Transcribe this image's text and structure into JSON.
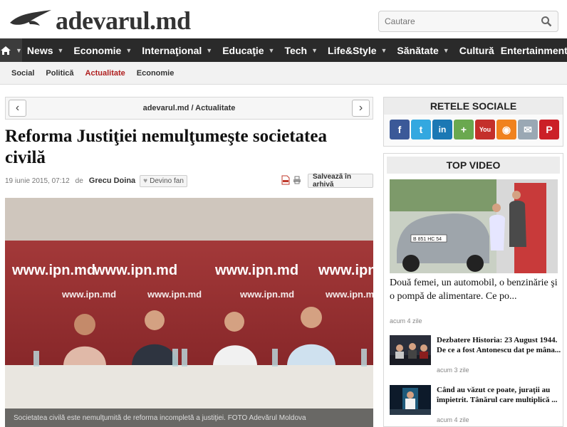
{
  "site": {
    "logo_text": "adevarul.md"
  },
  "search": {
    "placeholder": "Cautare"
  },
  "nav": {
    "items": [
      "News",
      "Economie",
      "Internaţional",
      "Educaţie",
      "Tech",
      "Life&Style",
      "Sănătate",
      "Cultură",
      "Entertainment"
    ]
  },
  "subnav": {
    "items": [
      "Social",
      "Politică",
      "Actualitate",
      "Economie"
    ],
    "active": "Actualitate"
  },
  "breadcrumb": {
    "home": "adevarul.md",
    "separator": " / ",
    "section": "Actualitate"
  },
  "article": {
    "title": "Reforma Justiţiei nemulţumeşte societatea civilă",
    "date": "19 iunie 2015, 07:12",
    "by": "de",
    "author": "Grecu Doina",
    "fan_label": "Devino fan",
    "save_label": "Salvează în arhivă",
    "caption": "Societatea civilă este nemulţumită de reforma incompletă a justiţiei. FOTO Adevărul Moldova",
    "banner_text": "www.ipn.md"
  },
  "sidebar": {
    "social_title": "RETELE SOCIALE",
    "social_icons": [
      "facebook-icon",
      "twitter-icon",
      "linkedin-icon",
      "googleplus-icon",
      "youtube-icon",
      "rss-icon",
      "email-icon",
      "pinterest-icon"
    ],
    "video_title": "TOP VIDEO",
    "main_video": {
      "title": "Două femei, un automobil, o benzinărie şi o pompă de alimentare. Ce po...",
      "date": "acum 4 zile",
      "plate": "B 851 HC 54"
    },
    "videos": [
      {
        "title": "Dezbatere Historia: 23 August 1944. De ce a fost Antonescu dat pe mâna...",
        "date": "acum 3 zile"
      },
      {
        "title": "Când au văzut ce poate, juraţii au împietrit. Tânărul care multiplică ...",
        "date": "acum 4 zile"
      }
    ]
  },
  "colors": {
    "nav_bg": "#2a2a2a",
    "accent": "#b02020"
  }
}
